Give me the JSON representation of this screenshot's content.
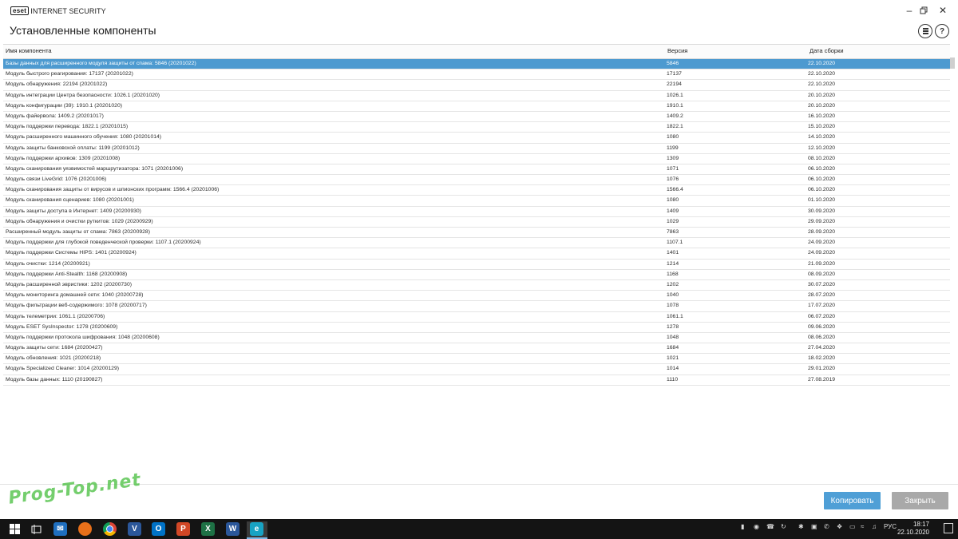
{
  "app": {
    "logo_badge": "eset",
    "logo_text": "INTERNET SECURITY"
  },
  "page": {
    "title": "Установленные компоненты"
  },
  "table": {
    "columns": {
      "name": "Имя компонента",
      "version": "Версия",
      "date": "Дата сборки"
    },
    "rows": [
      {
        "name": "Базы данных для расширенного модуля защиты от спама: 5846 (20201022)",
        "version": "5846",
        "date": "22.10.2020",
        "selected": true
      },
      {
        "name": "Модуль быстрого реагирования: 17137 (20201022)",
        "version": "17137",
        "date": "22.10.2020"
      },
      {
        "name": "Модуль обнаружения: 22194 (20201022)",
        "version": "22194",
        "date": "22.10.2020"
      },
      {
        "name": "Модуль интеграции Центра безопасности: 1026.1 (20201020)",
        "version": "1026.1",
        "date": "20.10.2020"
      },
      {
        "name": "Модуль конфигурации (39): 1910.1 (20201020)",
        "version": "1910.1",
        "date": "20.10.2020"
      },
      {
        "name": "Модуль файервола: 1409.2 (20201017)",
        "version": "1409.2",
        "date": "16.10.2020"
      },
      {
        "name": "Модуль поддержки перевода: 1822.1 (20201015)",
        "version": "1822.1",
        "date": "15.10.2020"
      },
      {
        "name": "Модуль расширенного машинного обучения: 1080 (20201014)",
        "version": "1080",
        "date": "14.10.2020"
      },
      {
        "name": "Модуль защиты банковской оплаты: 1199 (20201012)",
        "version": "1199",
        "date": "12.10.2020"
      },
      {
        "name": "Модуль поддержки архивов: 1309 (20201008)",
        "version": "1309",
        "date": "08.10.2020"
      },
      {
        "name": "Модуль сканирования уязвимостей маршрутизатора: 1071 (20201006)",
        "version": "1071",
        "date": "06.10.2020"
      },
      {
        "name": "Модуль связи LiveGrid: 1076 (20201006)",
        "version": "1076",
        "date": "06.10.2020"
      },
      {
        "name": "Модуль сканирования защиты от вирусов и шпионских программ: 1566.4 (20201006)",
        "version": "1566.4",
        "date": "06.10.2020"
      },
      {
        "name": "Модуль сканирования сценариев: 1080 (20201001)",
        "version": "1080",
        "date": "01.10.2020"
      },
      {
        "name": "Модуль защиты доступа в Интернет: 1409 (20200930)",
        "version": "1409",
        "date": "30.09.2020"
      },
      {
        "name": "Модуль обнаружения и очистки руткитов: 1029 (20200929)",
        "version": "1029",
        "date": "29.09.2020"
      },
      {
        "name": "Расширенный модуль защиты от спама: 7863 (20200928)",
        "version": "7863",
        "date": "28.09.2020"
      },
      {
        "name": "Модуль поддержки для глубокой поведенческой проверки: 1107.1 (20200924)",
        "version": "1107.1",
        "date": "24.09.2020"
      },
      {
        "name": "Модуль поддержки Системы HIPS: 1401 (20200924)",
        "version": "1401",
        "date": "24.09.2020"
      },
      {
        "name": "Модуль очистки: 1214 (20200921)",
        "version": "1214",
        "date": "21.09.2020"
      },
      {
        "name": "Модуль поддержки Anti-Stealth: 1168 (20200908)",
        "version": "1168",
        "date": "08.09.2020"
      },
      {
        "name": "Модуль расширенной эвристики: 1202 (20200730)",
        "version": "1202",
        "date": "30.07.2020"
      },
      {
        "name": "Модуль мониторинга домашней сети: 1040 (20200728)",
        "version": "1040",
        "date": "28.07.2020"
      },
      {
        "name": "Модуль фильтрации веб-содержимого: 1078 (20200717)",
        "version": "1078",
        "date": "17.07.2020"
      },
      {
        "name": "Модуль телеметрии: 1061.1 (20200706)",
        "version": "1061.1",
        "date": "06.07.2020"
      },
      {
        "name": "Модуль ESET SysInspector: 1278 (20200609)",
        "version": "1278",
        "date": "09.06.2020"
      },
      {
        "name": "Модуль поддержки протокола шифрования: 1048 (20200608)",
        "version": "1048",
        "date": "08.06.2020"
      },
      {
        "name": "Модуль защиты сети: 1684 (20200427)",
        "version": "1684",
        "date": "27.04.2020"
      },
      {
        "name": "Модуль обновления: 1021 (20200218)",
        "version": "1021",
        "date": "18.02.2020"
      },
      {
        "name": "Модуль Specialized Cleaner: 1014 (20200129)",
        "version": "1014",
        "date": "29.01.2020"
      },
      {
        "name": "Модуль базы данных: 1110 (20190827)",
        "version": "1110",
        "date": "27.08.2019"
      }
    ]
  },
  "buttons": {
    "copy": "Копировать",
    "close": "Закрыть"
  },
  "watermark": "Prog-Top.net",
  "taskbar": {
    "apps": [
      "windows-start-icon",
      "task-view-icon",
      "mail-icon",
      "firefox-icon",
      "chrome-icon",
      "visio-icon",
      "outlook-icon",
      "powerpoint-icon",
      "excel-icon",
      "word-icon",
      "eset-icon"
    ],
    "language": "РУС",
    "time": "18:17",
    "date": "22.10.2020"
  },
  "colors": {
    "selected_row": "#4d9ad0",
    "copy_button": "#4f9fd6",
    "close_button": "#a9a9a9",
    "taskbar": "#141414"
  }
}
